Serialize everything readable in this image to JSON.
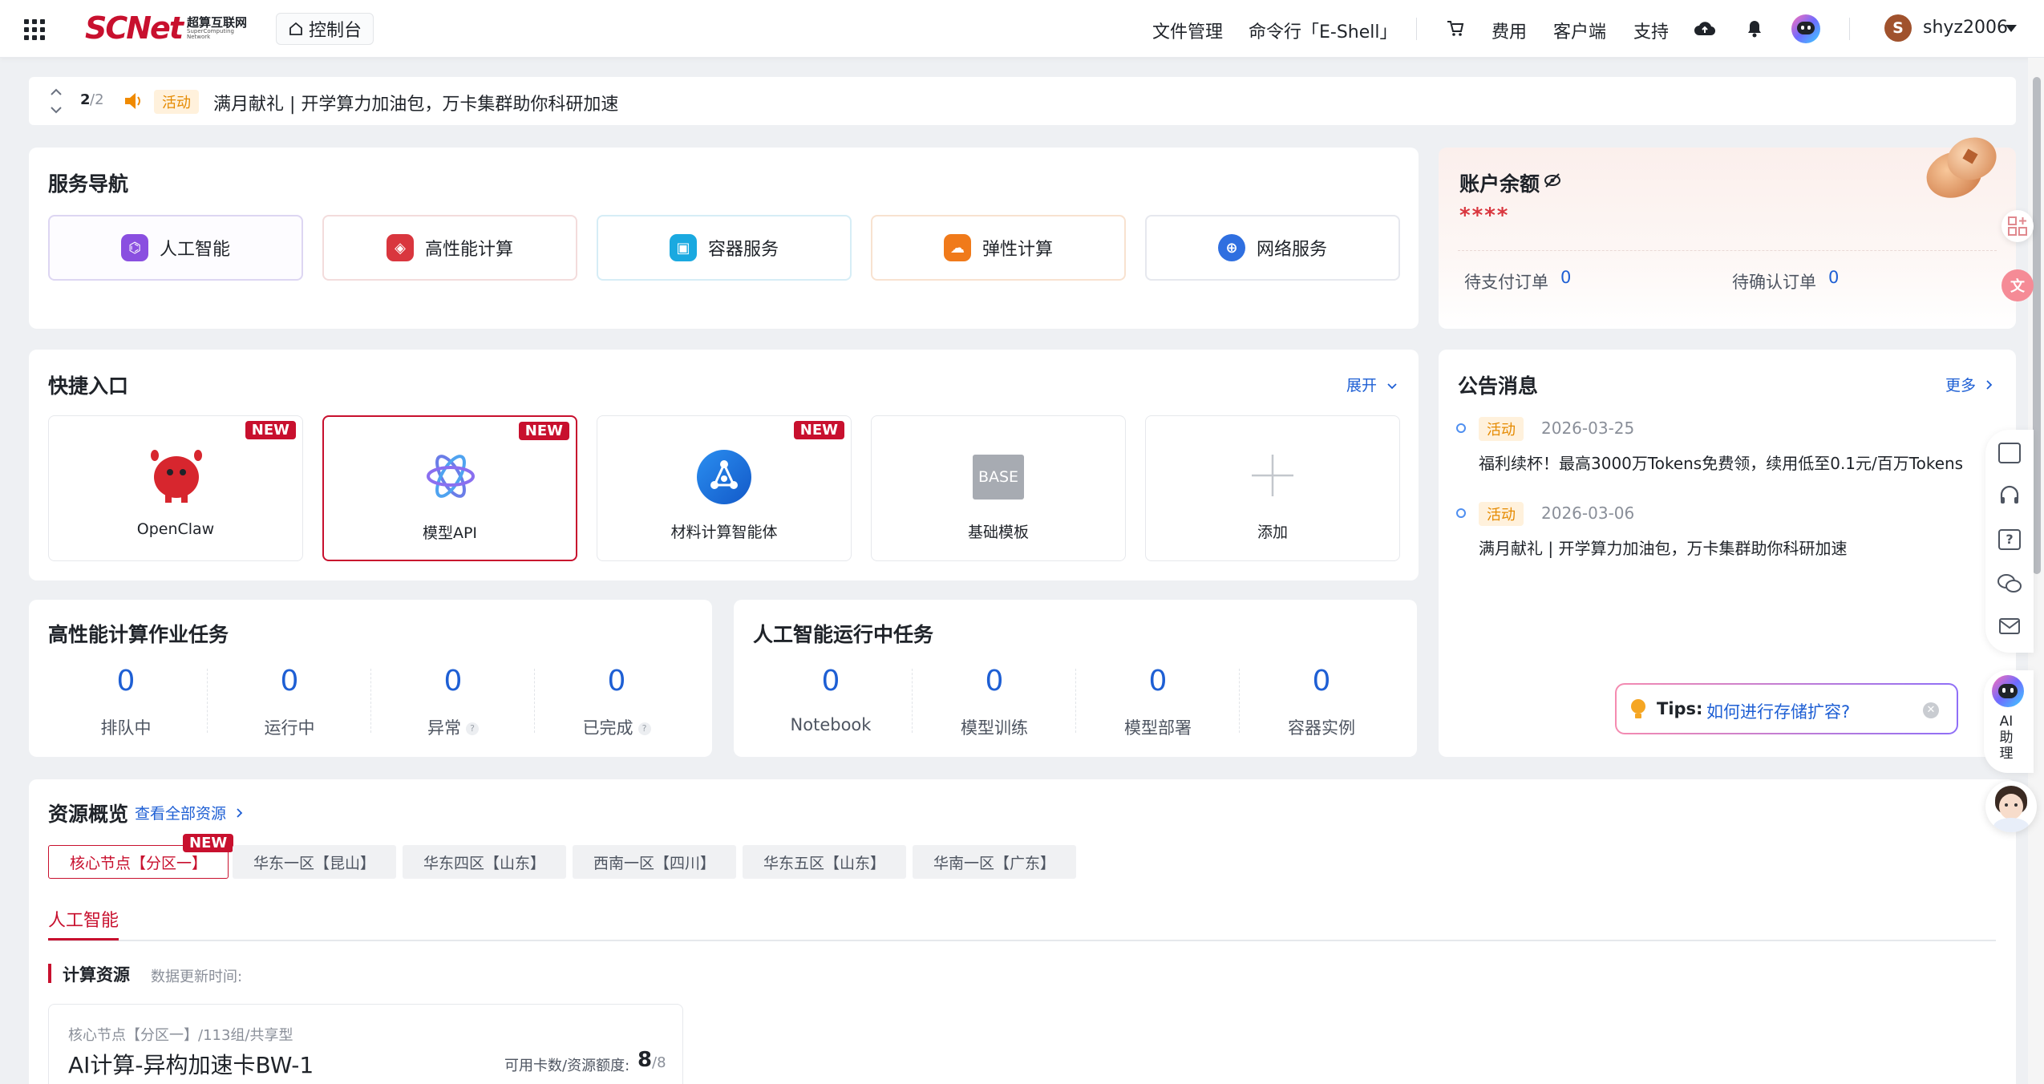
{
  "header": {
    "logo_main": "SCNet",
    "logo_cn": "超算互联网",
    "logo_en": "SuperComputing Network",
    "console_label": "控制台",
    "nav": [
      "文件管理",
      "命令行「E-Shell」",
      "费用",
      "客户端",
      "支持"
    ],
    "username": "shyz2006",
    "avatar_letter": "S"
  },
  "banner": {
    "page_current": "2",
    "page_total": "/2",
    "tag": "活动",
    "text": "满月献礼 | 开学算力加油包，万卡集群助你科研加速"
  },
  "service_nav": {
    "title": "服务导航",
    "items": [
      {
        "label": "人工智能",
        "color": "#8a4fe0"
      },
      {
        "label": "高性能计算",
        "color": "#d9363e"
      },
      {
        "label": "容器服务",
        "color": "#1aa9e0"
      },
      {
        "label": "弹性计算",
        "color": "#f07a1a"
      },
      {
        "label": "网络服务",
        "color": "#2f6fe0"
      }
    ]
  },
  "balance": {
    "title": "账户余额",
    "value": "****",
    "pending_pay_label": "待支付订单",
    "pending_pay": "0",
    "pending_confirm_label": "待确认订单",
    "pending_confirm": "0"
  },
  "quick_entry": {
    "title": "快捷入口",
    "expand": "展开",
    "new_label": "NEW",
    "items": [
      {
        "label": "OpenClaw",
        "new": true
      },
      {
        "label": "模型API",
        "new": true
      },
      {
        "label": "材料计算智能体",
        "new": true
      },
      {
        "label": "基础模板",
        "new": false
      },
      {
        "label": "添加",
        "new": false
      }
    ],
    "base_text": "BASE"
  },
  "notices": {
    "title": "公告消息",
    "more": "更多",
    "items": [
      {
        "tag": "活动",
        "date": "2026-03-25",
        "text": "福利续杯！最高3000万Tokens免费领，续用低至0.1元/百万Tokens"
      },
      {
        "tag": "活动",
        "date": "2026-03-06",
        "text": "满月献礼 | 开学算力加油包，万卡集群助你科研加速"
      }
    ]
  },
  "hpc_tasks": {
    "title": "高性能计算作业任务",
    "stats": [
      {
        "value": "0",
        "label": "排队中"
      },
      {
        "value": "0",
        "label": "运行中"
      },
      {
        "value": "0",
        "label": "异常"
      },
      {
        "value": "0",
        "label": "已完成"
      }
    ]
  },
  "ai_tasks": {
    "title": "人工智能运行中任务",
    "stats": [
      {
        "value": "0",
        "label": "Notebook"
      },
      {
        "value": "0",
        "label": "模型训练"
      },
      {
        "value": "0",
        "label": "模型部署"
      },
      {
        "value": "0",
        "label": "容器实例"
      }
    ]
  },
  "resources": {
    "title": "资源概览",
    "view_all": "查看全部资源",
    "regions": [
      "核心节点【分区一】",
      "华东一区【昆山】",
      "华东四区【山东】",
      "西南一区【四川】",
      "华东五区【山东】",
      "华南一区【广东】"
    ],
    "new_label": "NEW",
    "tab": "人工智能",
    "compute_title": "计算资源",
    "update_time_label": "数据更新时间:",
    "card_path": "核心节点【分区一】/113组/共享型",
    "card_name": "AI计算-异构加速卡BW-1",
    "quota_label": "可用卡数/资源额度:",
    "quota_available": "8",
    "quota_total": "/8"
  },
  "tips": {
    "label": "Tips:",
    "link": "如何进行存储扩容?"
  },
  "assistant": {
    "label": "AI助理"
  },
  "colors": {
    "brand": "#c8102e",
    "link": "#1e5fd4",
    "activity_tag": "#e58a00"
  }
}
